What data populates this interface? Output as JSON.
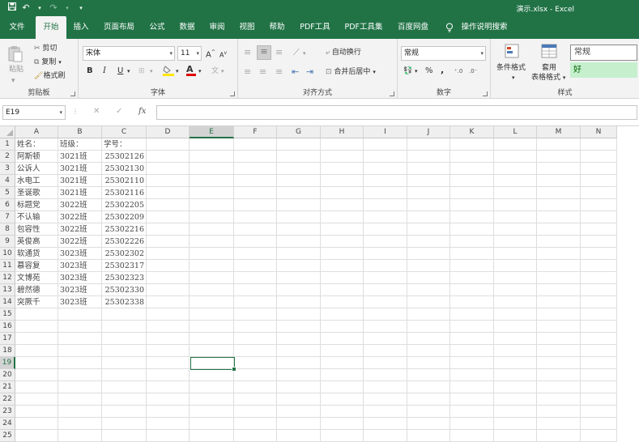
{
  "window": {
    "title": "演示.xlsx  -  Excel"
  },
  "qat": {
    "save_icon": "save-icon",
    "undo_icon": "undo-icon",
    "redo_icon": "redo-icon",
    "customize_icon": "customize-icon"
  },
  "menu": {
    "tabs": [
      "文件",
      "开始",
      "插入",
      "页面布局",
      "公式",
      "数据",
      "审阅",
      "视图",
      "帮助",
      "PDF工具",
      "PDF工具集",
      "百度网盘"
    ],
    "active": "开始",
    "tell_me": "操作说明搜索"
  },
  "ribbon": {
    "clipboard": {
      "name": "剪贴板",
      "paste": "粘贴",
      "cut": "剪切",
      "copy": "复制",
      "format_painter": "格式刷"
    },
    "font": {
      "name": "字体",
      "font_family": "宋体",
      "font_size": "11",
      "grow": "A",
      "shrink": "A",
      "bold": "B",
      "italic": "I",
      "underline": "U",
      "font_color_letter": "A"
    },
    "alignment": {
      "name": "对齐方式",
      "wrap_text": "自动换行",
      "merge_center": "合并后居中"
    },
    "number": {
      "name": "数字",
      "format": "常规",
      "percent": "%",
      "comma": ","
    },
    "styles": {
      "name": "样式",
      "conditional": "条件格式",
      "table_line1": "套用",
      "table_line2": "表格格式",
      "style_normal": "常规",
      "style_good": "好"
    }
  },
  "formula_bar": {
    "name_box": "E19",
    "cancel": "✕",
    "enter": "✓",
    "fx": "fx",
    "formula": ""
  },
  "sheet": {
    "columns": [
      "A",
      "B",
      "C",
      "D",
      "E",
      "F",
      "G",
      "H",
      "I",
      "J",
      "K",
      "L",
      "M",
      "N"
    ],
    "rows": [
      "1",
      "2",
      "3",
      "4",
      "5",
      "6",
      "7",
      "8",
      "9",
      "10",
      "11",
      "12",
      "13",
      "14",
      "15",
      "16",
      "17",
      "18",
      "19",
      "20",
      "21",
      "22",
      "23",
      "24",
      "25"
    ],
    "active_cell": "E19",
    "data": [
      [
        "姓名：",
        "班级：",
        "学号："
      ],
      [
        "阿斯顿",
        "3021班",
        "25302126"
      ],
      [
        "公诉人",
        "3021班",
        "25302130"
      ],
      [
        "水电工",
        "3021班",
        "25302110"
      ],
      [
        "圣诞歌",
        "3021班",
        "25302116"
      ],
      [
        "标题党",
        "3022班",
        "25302205"
      ],
      [
        "不认输",
        "3022班",
        "25302209"
      ],
      [
        "包容性",
        "3022班",
        "25302216"
      ],
      [
        "英俊高",
        "3022班",
        "25302226"
      ],
      [
        "软通货",
        "3023班",
        "25302302"
      ],
      [
        "慕容复",
        "3023班",
        "25302317"
      ],
      [
        "文博苑",
        "3023班",
        "25302323"
      ],
      [
        "碧然德",
        "3023班",
        "25302330"
      ],
      [
        "突厥千",
        "3023班",
        "25302338"
      ]
    ]
  }
}
